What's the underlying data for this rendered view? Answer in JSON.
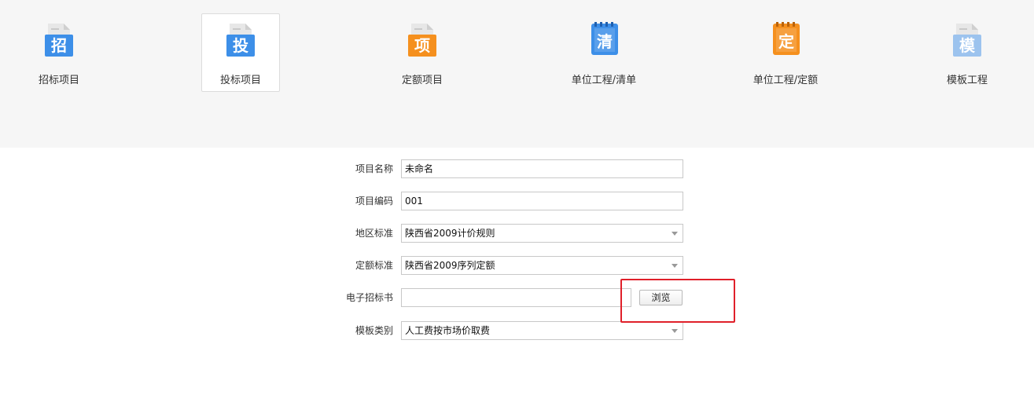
{
  "toolbar": {
    "items": [
      {
        "label": "招标项目",
        "icon_char": "招",
        "icon": "tender-project-icon",
        "color": "#3d8fe8",
        "selected": false
      },
      {
        "label": "投标项目",
        "icon_char": "投",
        "icon": "bid-project-icon",
        "color": "#3d8fe8",
        "selected": true
      },
      {
        "label": "定额项目",
        "icon_char": "项",
        "icon": "quota-project-icon",
        "color": "#f5901e",
        "selected": false
      },
      {
        "label": "单位工程/清单",
        "icon_char": "清",
        "icon": "unit-bill-icon",
        "color": "#3d8fe8",
        "selected": false
      },
      {
        "label": "单位工程/定额",
        "icon_char": "定",
        "icon": "unit-quota-icon",
        "color": "#f5901e",
        "selected": false
      },
      {
        "label": "模板工程",
        "icon_char": "模",
        "icon": "template-project-icon",
        "color": "#9cc3ee",
        "selected": false
      }
    ]
  },
  "form": {
    "project_name": {
      "label": "项目名称",
      "value": "未命名"
    },
    "project_code": {
      "label": "项目编码",
      "value": "001"
    },
    "region_standard": {
      "label": "地区标准",
      "value": "陕西省2009计价规则"
    },
    "quota_standard": {
      "label": "定额标准",
      "value": "陕西省2009序列定额"
    },
    "e_tender_doc": {
      "label": "电子招标书",
      "value": "",
      "browse_label": "浏览"
    },
    "template_type": {
      "label": "模板类别",
      "value": "人工费按市场价取费"
    }
  },
  "colors": {
    "highlight": "#e0202a",
    "blue": "#3d8fe8",
    "orange": "#f5901e",
    "light_blue": "#9cc3ee"
  }
}
